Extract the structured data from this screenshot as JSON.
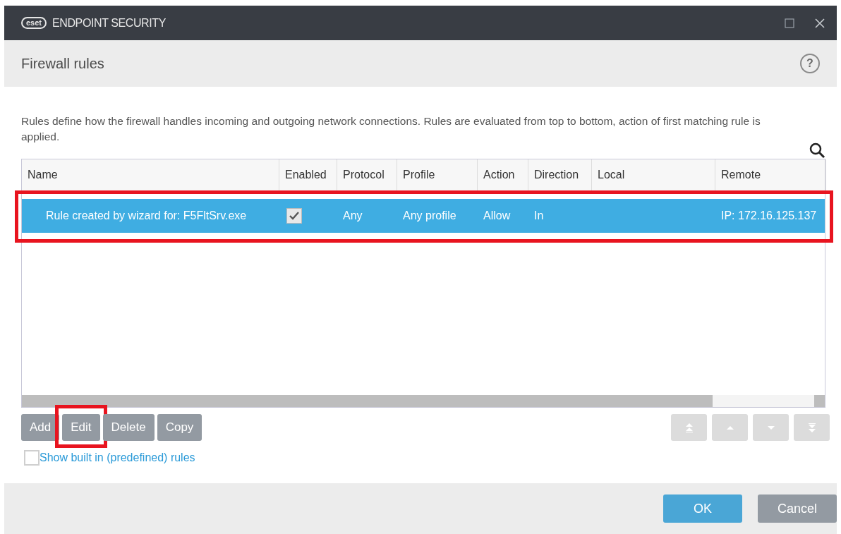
{
  "window": {
    "logo": "eset",
    "title": "ENDPOINT SECURITY"
  },
  "header": {
    "title": "Firewall rules",
    "help": "?"
  },
  "description": "Rules define how the firewall handles incoming and outgoing network connections. Rules are evaluated from top to bottom, action of first matching rule is applied.",
  "table": {
    "columns": [
      "Name",
      "Enabled",
      "Protocol",
      "Profile",
      "Action",
      "Direction",
      "Local",
      "Remote"
    ],
    "rows": [
      {
        "selected": true,
        "highlighted": true,
        "name": "Rule created by wizard for: F5FltSrv.exe",
        "enabled": true,
        "protocol": "Any",
        "profile": "Any profile",
        "action": "Allow",
        "direction": "In",
        "local": "",
        "remote": "IP: 172.16.125.137"
      }
    ]
  },
  "buttons": [
    {
      "label": "Add",
      "highlighted": false
    },
    {
      "label": "Edit",
      "highlighted": true
    },
    {
      "label": "Delete",
      "highlighted": false
    },
    {
      "label": "Copy",
      "highlighted": false
    }
  ],
  "move_buttons": [
    {
      "kind": "top",
      "disabled": true
    },
    {
      "kind": "up",
      "disabled": true
    },
    {
      "kind": "down",
      "disabled": true
    },
    {
      "kind": "bottom",
      "disabled": true
    }
  ],
  "show_builtin": {
    "label": "Show built in (predefined) rules",
    "checked": false
  },
  "footer": {
    "ok": "OK",
    "cancel": "Cancel"
  }
}
